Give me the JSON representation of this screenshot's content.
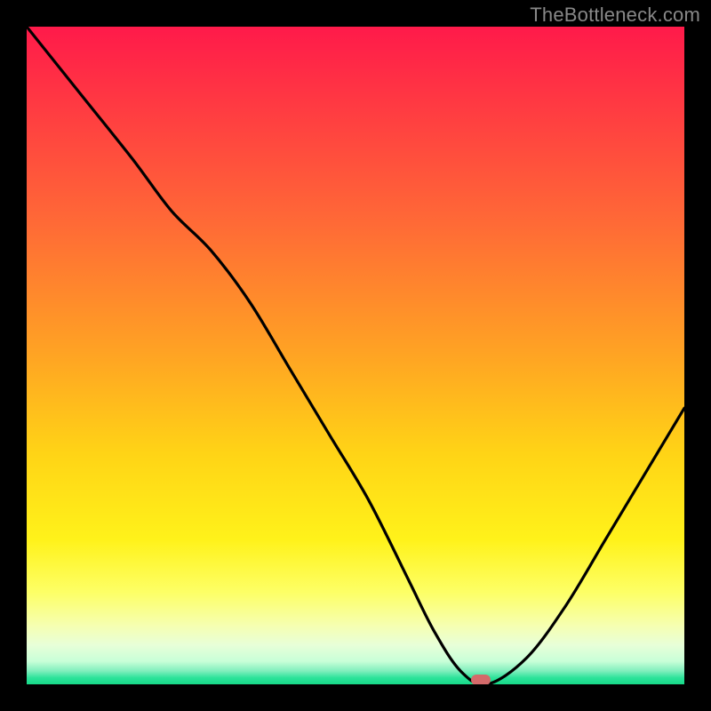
{
  "attribution": "TheBottleneck.com",
  "chart_data": {
    "type": "line",
    "title": "",
    "xlabel": "",
    "ylabel": "",
    "xlim": [
      0,
      100
    ],
    "ylim": [
      0,
      100
    ],
    "series": [
      {
        "name": "bottleneck-curve",
        "x": [
          0,
          8,
          16,
          22,
          28,
          34,
          40,
          46,
          52,
          58,
          62,
          66,
          70,
          76,
          82,
          88,
          94,
          100
        ],
        "y": [
          100,
          90,
          80,
          72,
          66,
          58,
          48,
          38,
          28,
          16,
          8,
          2,
          0,
          4,
          12,
          22,
          32,
          42
        ]
      }
    ],
    "marker": {
      "x": 69,
      "y": 0.7
    },
    "background_gradient": {
      "top": "#ff1a4a",
      "mid": "#ffd416",
      "bottom": "#16d988"
    }
  }
}
